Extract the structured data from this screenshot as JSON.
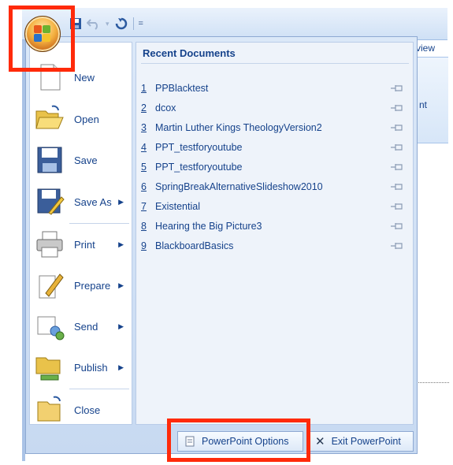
{
  "qat": {
    "dropdown_glyph": "▾",
    "customize_glyph": "="
  },
  "ribbon": {
    "tab_fragment": "view",
    "panel_fragment": "nt"
  },
  "menu": {
    "items": [
      {
        "label": "New",
        "icon": "new-document-icon",
        "has_arrow": false
      },
      {
        "label": "Open",
        "icon": "open-folder-icon",
        "has_arrow": false
      },
      {
        "label": "Save",
        "icon": "floppy-disk-icon",
        "has_arrow": false
      },
      {
        "label": "Save As",
        "icon": "save-as-icon",
        "has_arrow": true
      },
      {
        "label": "Print",
        "icon": "printer-icon",
        "has_arrow": true
      },
      {
        "label": "Prepare",
        "icon": "prepare-pen-icon",
        "has_arrow": true
      },
      {
        "label": "Send",
        "icon": "send-icon",
        "has_arrow": true
      },
      {
        "label": "Publish",
        "icon": "publish-folder-icon",
        "has_arrow": true
      },
      {
        "label": "Close",
        "icon": "close-folder-icon",
        "has_arrow": false
      }
    ],
    "arrow_glyph": "▶"
  },
  "recent": {
    "title": "Recent Documents",
    "items": [
      {
        "num": "1",
        "name": "PPBlacktest"
      },
      {
        "num": "2",
        "name": "dcox"
      },
      {
        "num": "3",
        "name": "Martin Luther Kings TheologyVersion2"
      },
      {
        "num": "4",
        "name": "PPT_testforyoutube"
      },
      {
        "num": "5",
        "name": "PPT_testforyoutube"
      },
      {
        "num": "6",
        "name": "SpringBreakAlternativeSlideshow2010"
      },
      {
        "num": "7",
        "name": "Existential"
      },
      {
        "num": "8",
        "name": "Hearing the Big Picture3"
      },
      {
        "num": "9",
        "name": "BlackboardBasics"
      }
    ]
  },
  "bottom": {
    "options_label": "PowerPoint Options",
    "exit_label": "Exit PowerPoint",
    "exit_glyph": "✕"
  },
  "colors": {
    "highlight": "#ff2a0a",
    "menu_text": "#15428b",
    "menu_bg": "#c7d9f1"
  }
}
